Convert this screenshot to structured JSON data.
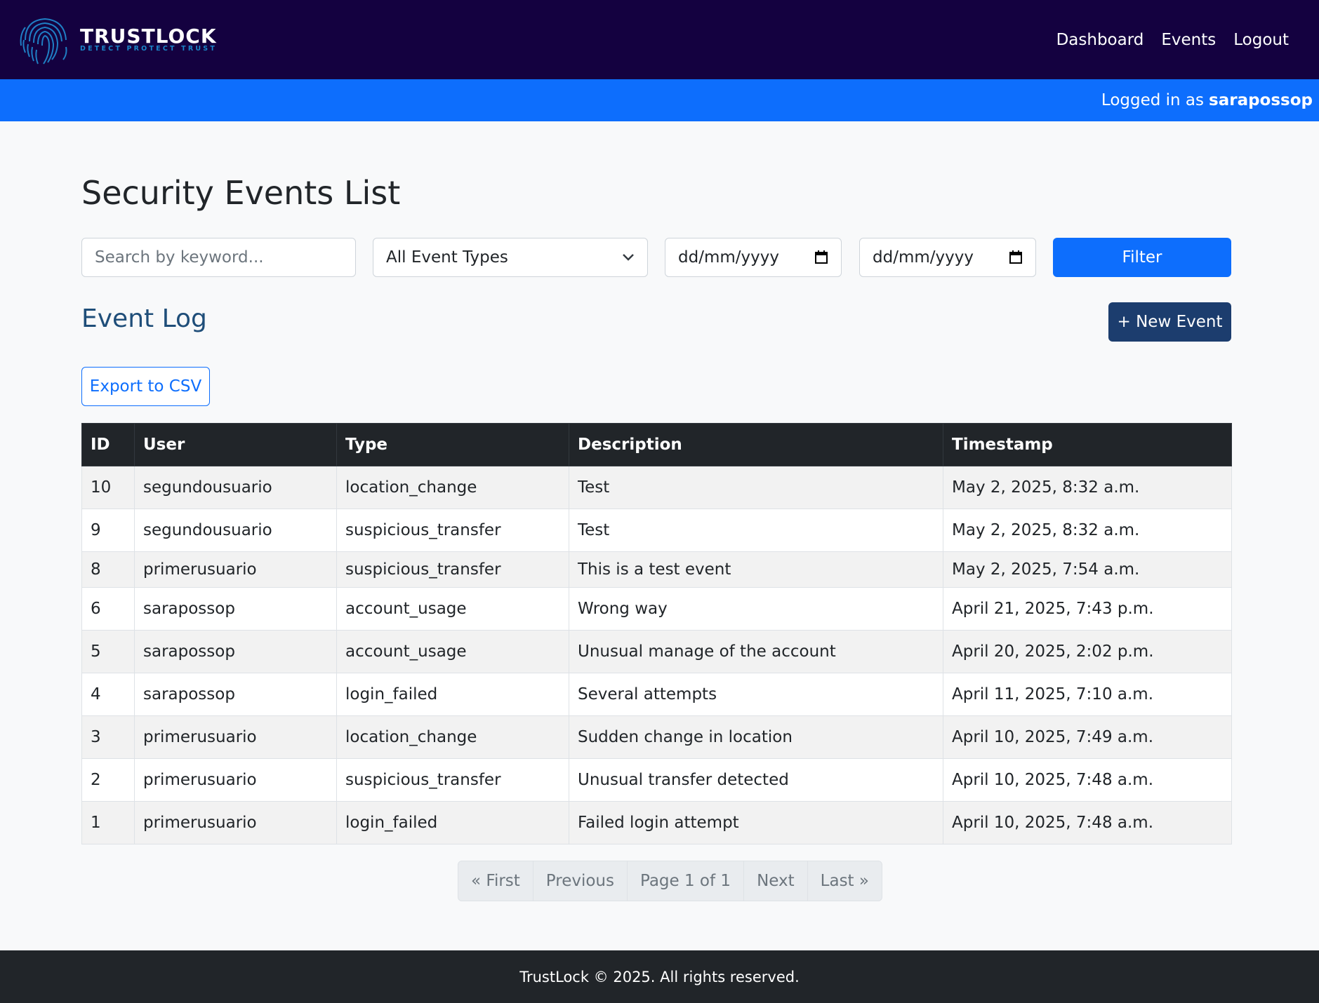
{
  "brand": {
    "name": "TRUSTLOCK",
    "tagline": "DETECT PROTECT TRUST"
  },
  "nav": {
    "links": [
      "Dashboard",
      "Events",
      "Logout"
    ]
  },
  "userbar": {
    "prefix": "Logged in as",
    "username": "sarapossop"
  },
  "page": {
    "title": "Security Events List"
  },
  "filters": {
    "search_placeholder": "Search by keyword...",
    "event_type_selected": "All Event Types",
    "date_from_placeholder": "dd/mm/yyyy",
    "date_to_placeholder": "dd/mm/yyyy",
    "filter_label": "Filter"
  },
  "section": {
    "title": "Event Log",
    "new_event_label": "+ New Event",
    "export_label": "Export to CSV"
  },
  "table": {
    "headers": [
      "ID",
      "User",
      "Type",
      "Description",
      "Timestamp"
    ],
    "rows": [
      [
        "10",
        "segundousuario",
        "location_change",
        "Test",
        "May 2, 2025, 8:32 a.m."
      ],
      [
        "9",
        "segundousuario",
        "suspicious_transfer",
        "Test",
        "May 2, 2025, 8:32 a.m."
      ],
      [
        "8",
        "primerusuario",
        "suspicious_transfer",
        "This is a test event",
        "May 2, 2025, 7:54 a.m."
      ],
      [
        "6",
        "sarapossop",
        "account_usage",
        "Wrong way",
        "April 21, 2025, 7:43 p.m."
      ],
      [
        "5",
        "sarapossop",
        "account_usage",
        "Unusual manage of the account",
        "April 20, 2025, 2:02 p.m."
      ],
      [
        "4",
        "sarapossop",
        "login_failed",
        "Several attempts",
        "April 11, 2025, 7:10 a.m."
      ],
      [
        "3",
        "primerusuario",
        "location_change",
        "Sudden change in location",
        "April 10, 2025, 7:49 a.m."
      ],
      [
        "2",
        "primerusuario",
        "suspicious_transfer",
        "Unusual transfer detected",
        "April 10, 2025, 7:48 a.m."
      ],
      [
        "1",
        "primerusuario",
        "login_failed",
        "Failed login attempt",
        "April 10, 2025, 7:48 a.m."
      ]
    ]
  },
  "pagination": {
    "first": "« First",
    "previous": "Previous",
    "current": "Page 1 of 1",
    "next": "Next",
    "last": "Last »"
  },
  "footer": {
    "text": "TrustLock © 2025. All rights reserved."
  },
  "colors": {
    "nav_bg": "#140140",
    "userbar_bg": "#0d6efd",
    "primary": "#0d6efd",
    "new_event_bg": "#1c3d6e",
    "table_header_bg": "#212529",
    "footer_bg": "#212529"
  }
}
